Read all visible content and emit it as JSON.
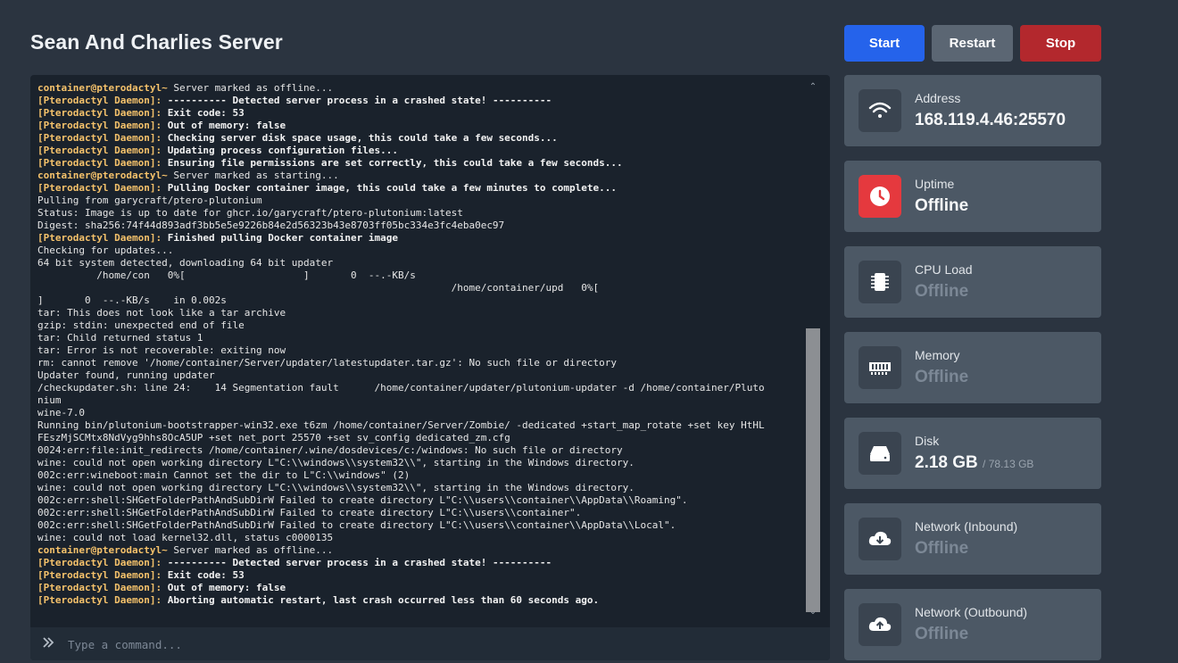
{
  "server": {
    "name": "Sean And Charlies Server"
  },
  "controls": {
    "start": "Start",
    "restart": "Restart",
    "stop": "Stop"
  },
  "console": {
    "lines": [
      [
        {
          "t": "container@pterodactyl~",
          "c": "container"
        },
        {
          "t": " Server marked as offline..."
        }
      ],
      [
        {
          "t": "[Pterodactyl Daemon]:",
          "c": "daemon"
        },
        {
          "t": " ---------- Detected server process in a crashed state! ----------",
          "c": "bold"
        }
      ],
      [
        {
          "t": "[Pterodactyl Daemon]:",
          "c": "daemon"
        },
        {
          "t": " Exit code: 53",
          "c": "bold"
        }
      ],
      [
        {
          "t": "[Pterodactyl Daemon]:",
          "c": "daemon"
        },
        {
          "t": " Out of memory: false",
          "c": "bold"
        }
      ],
      [
        {
          "t": "[Pterodactyl Daemon]:",
          "c": "daemon"
        },
        {
          "t": " Checking server disk space usage, this could take a few seconds...",
          "c": "bold"
        }
      ],
      [
        {
          "t": "[Pterodactyl Daemon]:",
          "c": "daemon"
        },
        {
          "t": " Updating process configuration files...",
          "c": "bold"
        }
      ],
      [
        {
          "t": "[Pterodactyl Daemon]:",
          "c": "daemon"
        },
        {
          "t": " Ensuring file permissions are set correctly, this could take a few seconds...",
          "c": "bold"
        }
      ],
      [
        {
          "t": "container@pterodactyl~",
          "c": "container"
        },
        {
          "t": " Server marked as starting..."
        }
      ],
      [
        {
          "t": "[Pterodactyl Daemon]:",
          "c": "daemon"
        },
        {
          "t": " Pulling Docker container image, this could take a few minutes to complete...",
          "c": "bold"
        }
      ],
      [
        {
          "t": "Pulling from garycraft/ptero-plutonium"
        }
      ],
      [
        {
          "t": "Status: Image is up to date for ghcr.io/garycraft/ptero-plutonium:latest"
        }
      ],
      [
        {
          "t": "Digest: sha256:74f44d893adf3bb5e5e9226b84e2d56323b43e8703ff05bc334e3fc4eba0ec97"
        }
      ],
      [
        {
          "t": "[Pterodactyl Daemon]:",
          "c": "daemon"
        },
        {
          "t": " Finished pulling Docker container image",
          "c": "bold"
        }
      ],
      [
        {
          "t": "Checking for updates..."
        }
      ],
      [
        {
          "t": "64 bit system detected, downloading 64 bit updater"
        }
      ],
      [
        {
          "t": "          /home/con   0%[                    ]       0  --.-KB/s"
        }
      ],
      [
        {
          "t": "                                                                      /home/container/upd   0%["
        }
      ],
      [
        {
          "t": "]       0  --.-KB/s    in 0.002s"
        }
      ],
      [
        {
          "t": "tar: This does not look like a tar archive"
        }
      ],
      [
        {
          "t": "gzip: stdin: unexpected end of file"
        }
      ],
      [
        {
          "t": "tar: Child returned status 1"
        }
      ],
      [
        {
          "t": "tar: Error is not recoverable: exiting now"
        }
      ],
      [
        {
          "t": "rm: cannot remove '/home/container/Server/updater/latestupdater.tar.gz': No such file or directory"
        }
      ],
      [
        {
          "t": "Updater found, running updater"
        }
      ],
      [
        {
          "t": "/checkupdater.sh: line 24:    14 Segmentation fault      /home/container/updater/plutonium-updater -d /home/container/Pluto"
        }
      ],
      [
        {
          "t": "nium"
        }
      ],
      [
        {
          "t": "wine-7.0"
        }
      ],
      [
        {
          "t": "Running bin/plutonium-bootstrapper-win32.exe t6zm /home/container/Server/Zombie/ -dedicated +start_map_rotate +set key HtHL"
        }
      ],
      [
        {
          "t": "FEszMjSCMtx8NdVyg9hhs8OcA5UP +set net_port 25570 +set sv_config dedicated_zm.cfg"
        }
      ],
      [
        {
          "t": "0024:err:file:init_redirects /home/container/.wine/dosdevices/c:/windows: No such file or directory"
        }
      ],
      [
        {
          "t": "wine: could not open working directory L\"C:\\\\windows\\\\system32\\\\\", starting in the Windows directory."
        }
      ],
      [
        {
          "t": "002c:err:wineboot:main Cannot set the dir to L\"C:\\\\windows\" (2)"
        }
      ],
      [
        {
          "t": "wine: could not open working directory L\"C:\\\\windows\\\\system32\\\\\", starting in the Windows directory."
        }
      ],
      [
        {
          "t": "002c:err:shell:SHGetFolderPathAndSubDirW Failed to create directory L\"C:\\\\users\\\\container\\\\AppData\\\\Roaming\"."
        }
      ],
      [
        {
          "t": "002c:err:shell:SHGetFolderPathAndSubDirW Failed to create directory L\"C:\\\\users\\\\container\"."
        }
      ],
      [
        {
          "t": "002c:err:shell:SHGetFolderPathAndSubDirW Failed to create directory L\"C:\\\\users\\\\container\\\\AppData\\\\Local\"."
        }
      ],
      [
        {
          "t": "wine: could not load kernel32.dll, status c0000135"
        }
      ],
      [
        {
          "t": "container@pterodactyl~",
          "c": "container"
        },
        {
          "t": " Server marked as offline..."
        }
      ],
      [
        {
          "t": "[Pterodactyl Daemon]:",
          "c": "daemon"
        },
        {
          "t": " ---------- Detected server process in a crashed state! ----------",
          "c": "bold"
        }
      ],
      [
        {
          "t": "[Pterodactyl Daemon]:",
          "c": "daemon"
        },
        {
          "t": " Exit code: 53",
          "c": "bold"
        }
      ],
      [
        {
          "t": "[Pterodactyl Daemon]:",
          "c": "daemon"
        },
        {
          "t": " Out of memory: false",
          "c": "bold"
        }
      ],
      [
        {
          "t": "[Pterodactyl Daemon]:",
          "c": "daemon"
        },
        {
          "t": " Aborting automatic restart, last crash occurred less than 60 seconds ago.",
          "c": "bold"
        }
      ]
    ],
    "command_placeholder": "Type a command...",
    "command_icon": "chevrons-right-icon"
  },
  "stats": {
    "address": {
      "label": "Address",
      "value": "168.119.4.46:25570",
      "icon": "wifi-icon"
    },
    "uptime": {
      "label": "Uptime",
      "value": "Offline",
      "icon": "clock-icon"
    },
    "cpu": {
      "label": "CPU Load",
      "value": "Offline",
      "icon": "chip-icon"
    },
    "memory": {
      "label": "Memory",
      "value": "Offline",
      "icon": "memory-icon"
    },
    "disk": {
      "label": "Disk",
      "value": "2.18 GB",
      "limit": "/ 78.13 GB",
      "icon": "hard-drive-icon"
    },
    "network_in": {
      "label": "Network (Inbound)",
      "value": "Offline",
      "icon": "cloud-download-icon"
    },
    "network_out": {
      "label": "Network (Outbound)",
      "value": "Offline",
      "icon": "cloud-upload-icon"
    }
  },
  "colors": {
    "background": "#2b3440",
    "console_bg": "#1a222c",
    "card_bg": "#4c5865",
    "start": "#2563eb",
    "restart": "#5b6673",
    "stop": "#b3282d",
    "uptime_icon_bg": "#e5393e",
    "daemon_prefix": "#f5c26b"
  }
}
